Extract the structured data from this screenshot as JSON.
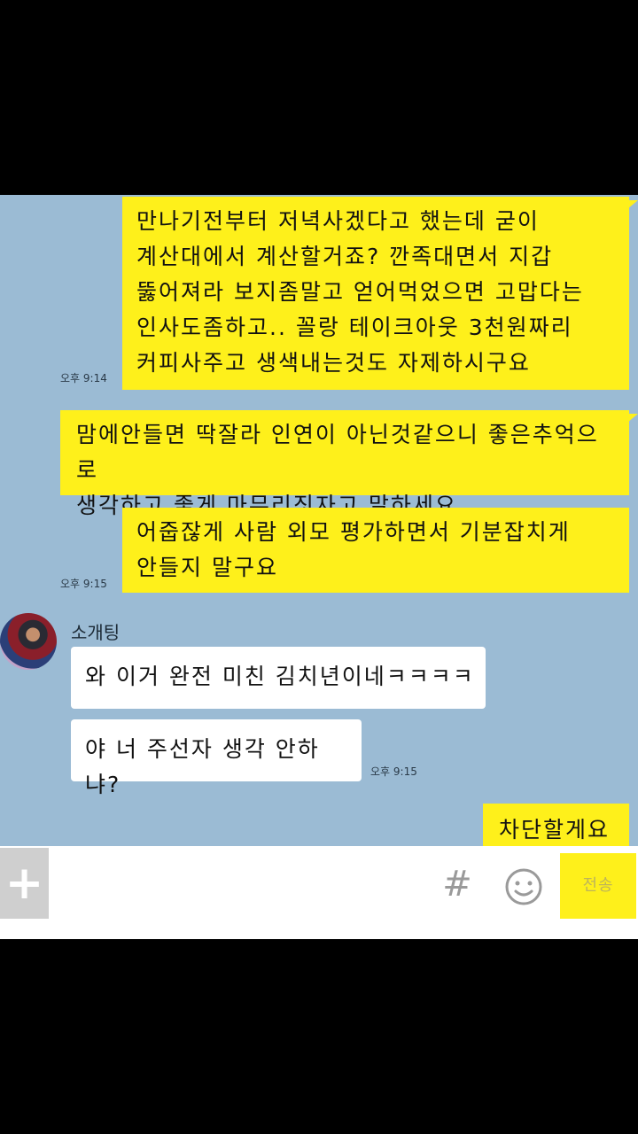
{
  "messages": [
    {
      "side": "me",
      "text": "만나기전부터 저녁사겠다고 했는데 굳이\n계산대에서 계산할거죠? 깐족대면서 지갑\n뚫어져라 보지좀말고 얻어먹었으면 고맙다는\n인사도좀하고.. 꼴랑 테이크아웃 3천원짜리\n커피사주고 생색내는것도 자제하시구요",
      "time": "오후 9:14"
    },
    {
      "side": "me",
      "text": "맘에안들면 딱잘라 인연이 아닌것같으니 좋은추억으로\n생각하고 좋게 마무리짓자고 말하세요"
    },
    {
      "side": "me",
      "text": "어줍잖게 사람 외모 평가하면서 기분잡치게\n안들지 말구요",
      "time": "오후 9:15"
    },
    {
      "side": "other",
      "sender": "소개팅",
      "text": "와 이거 완전 미친 김치년이네ㅋㅋㅋㅋ"
    },
    {
      "side": "other",
      "text": "야 너 주선자 생각 안하냐?",
      "time": "오후 9:15"
    },
    {
      "side": "me",
      "text": "차단할게요"
    }
  ],
  "input_bar": {
    "plus_label": "+",
    "hash_label": "#",
    "send_label": "전송",
    "message_value": ""
  },
  "icons": {
    "plus": "plus-icon",
    "hash": "hash-icon",
    "emoji": "emoji-icon",
    "avatar": "avatar"
  },
  "colors": {
    "chat_background": "#9bbbd4",
    "my_bubble": "#fef01b",
    "other_bubble": "#ffffff",
    "screen_background": "#000000"
  }
}
